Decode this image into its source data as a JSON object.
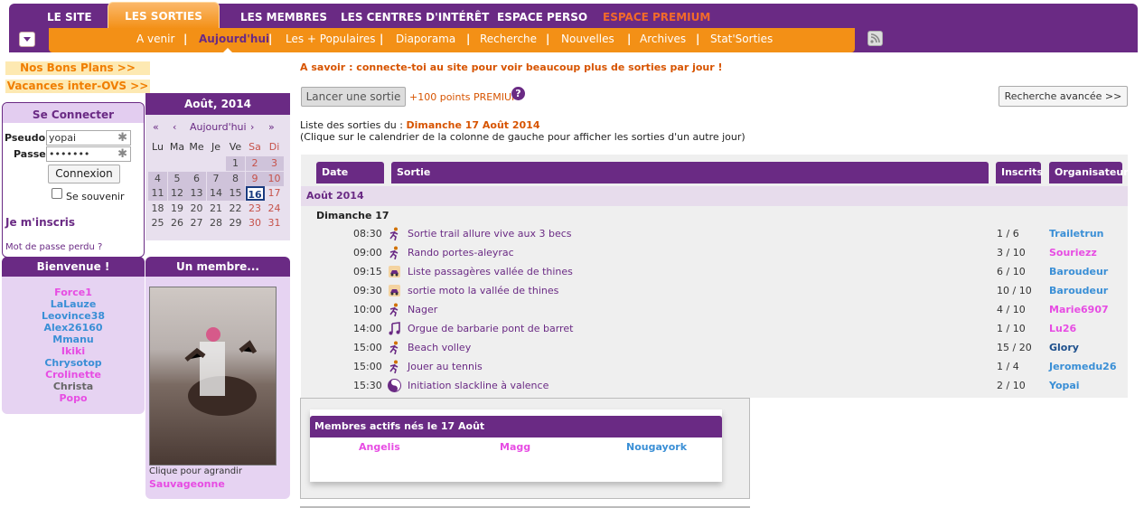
{
  "nav": {
    "items": [
      "LE SITE",
      "LES SORTIES",
      "LES MEMBRES",
      "LES CENTRES D'INTÉRÊT",
      "ESPACE PERSO",
      "ESPACE PREMIUM"
    ],
    "sub": [
      "A venir",
      "Aujourd'hui",
      "Les + Populaires",
      "Diaporama",
      "Recherche",
      "Nouvelles",
      "Archives",
      "Stat'Sorties"
    ],
    "sep": "|"
  },
  "promo": {
    "bons_plans": "Nos Bons Plans >>",
    "vacances": "Vacances inter-OVS >>"
  },
  "login": {
    "title": "Se Connecter",
    "pseudo_label": "Pseudo",
    "pseudo_value": "yopai",
    "passe_label": "Passe",
    "passe_value": "•••••••",
    "submit": "Connexion",
    "remember": "Se souvenir",
    "register": "Je m'inscris",
    "forgot": "Mot de passe perdu ?"
  },
  "calendar": {
    "title": "Août, 2014",
    "nav": [
      "«",
      "‹",
      "Aujourd'hui",
      "›",
      "»"
    ],
    "days": [
      "Lu",
      "Ma",
      "Me",
      "Je",
      "Ve",
      "Sa",
      "Di"
    ],
    "weeks": [
      [
        "",
        "",
        "",
        "",
        "1",
        "2",
        "3"
      ],
      [
        "4",
        "5",
        "6",
        "7",
        "8",
        "9",
        "10"
      ],
      [
        "11",
        "12",
        "13",
        "14",
        "15",
        "16",
        "17"
      ],
      [
        "18",
        "19",
        "20",
        "21",
        "22",
        "23",
        "24"
      ],
      [
        "25",
        "26",
        "27",
        "28",
        "29",
        "30",
        "31"
      ]
    ],
    "selected": "16"
  },
  "welcome": {
    "title": "Bienvenue !",
    "members": [
      {
        "n": "Force1",
        "c": "#e74ce3"
      },
      {
        "n": "LaLauze",
        "c": "#3a8fd6"
      },
      {
        "n": "Leovince38",
        "c": "#3a8fd6"
      },
      {
        "n": "Alex26160",
        "c": "#3a8fd6"
      },
      {
        "n": "Mmanu",
        "c": "#3a8fd6"
      },
      {
        "n": "Ikiki",
        "c": "#e74ce3"
      },
      {
        "n": "Chrysotop",
        "c": "#3a8fd6"
      },
      {
        "n": "Crolinette",
        "c": "#e74ce3"
      },
      {
        "n": "Christa",
        "c": "#666666"
      },
      {
        "n": "Popo",
        "c": "#e74ce3"
      }
    ]
  },
  "member": {
    "title": "Un membre...",
    "caption": "Clique pour agrandir",
    "name": "Sauvageonne"
  },
  "main": {
    "notice": "A savoir : connecte-toi au site pour voir beaucoup plus de sorties par jour !",
    "launch": "Lancer une sortie",
    "premium": "+100 points PREMIUM",
    "advanced": "Recherche avancée >>",
    "list_prefix": "Liste des sorties du : ",
    "list_date": "Dimanche 17 Août 2014",
    "list_hint": "(Clique sur le calendrier de la colonne de gauche pour afficher les sorties d'un autre jour)",
    "headers": [
      "Date",
      "Sortie",
      "Inscrits",
      "Organisateur"
    ],
    "month": "Août 2014",
    "day": "Dimanche 17",
    "rows": [
      {
        "t": "08:30",
        "i": "run",
        "n": "Sortie trail allure vive aux 3 becs",
        "ins": "1 / 6",
        "o": "Trailetrun",
        "c": "#3a8fd6"
      },
      {
        "t": "09:00",
        "i": "run",
        "n": "Rando portes-aleyrac",
        "ins": "3 / 10",
        "o": "Souriezz",
        "c": "#e74ce3"
      },
      {
        "t": "09:15",
        "i": "car",
        "n": "Liste passagères vallée de thines",
        "ins": "6 / 10",
        "o": "Baroudeur",
        "c": "#3a8fd6"
      },
      {
        "t": "09:30",
        "i": "car",
        "n": "sortie moto la vallée de thines",
        "ins": "10 / 10",
        "o": "Baroudeur",
        "c": "#3a8fd6"
      },
      {
        "t": "10:00",
        "i": "run",
        "n": "Nager",
        "ins": "4 / 10",
        "o": "Marie6907",
        "c": "#e74ce3"
      },
      {
        "t": "14:00",
        "i": "music",
        "n": "Orgue de barbarie pont de barret",
        "ins": "1 / 10",
        "o": "Lu26",
        "c": "#e74ce3"
      },
      {
        "t": "15:00",
        "i": "run",
        "n": "Beach volley",
        "ins": "15 / 20",
        "o": "Glory",
        "c": "#1d4f8c"
      },
      {
        "t": "15:00",
        "i": "run",
        "n": "Jouer au tennis",
        "ins": "1 / 4",
        "o": "Jeromedu26",
        "c": "#3a8fd6"
      },
      {
        "t": "15:30",
        "i": "yin",
        "n": "Initiation slackline à valence",
        "ins": "2 / 10",
        "o": "Yopai",
        "c": "#3a8fd6"
      }
    ]
  },
  "birthday": {
    "title": "Membres actifs nés le 17 Août",
    "members": [
      {
        "n": "Angelis",
        "c": "#e74ce3"
      },
      {
        "n": "Magg",
        "c": "#e74ce3"
      },
      {
        "n": "Nougayork",
        "c": "#3a8fd6"
      }
    ]
  }
}
